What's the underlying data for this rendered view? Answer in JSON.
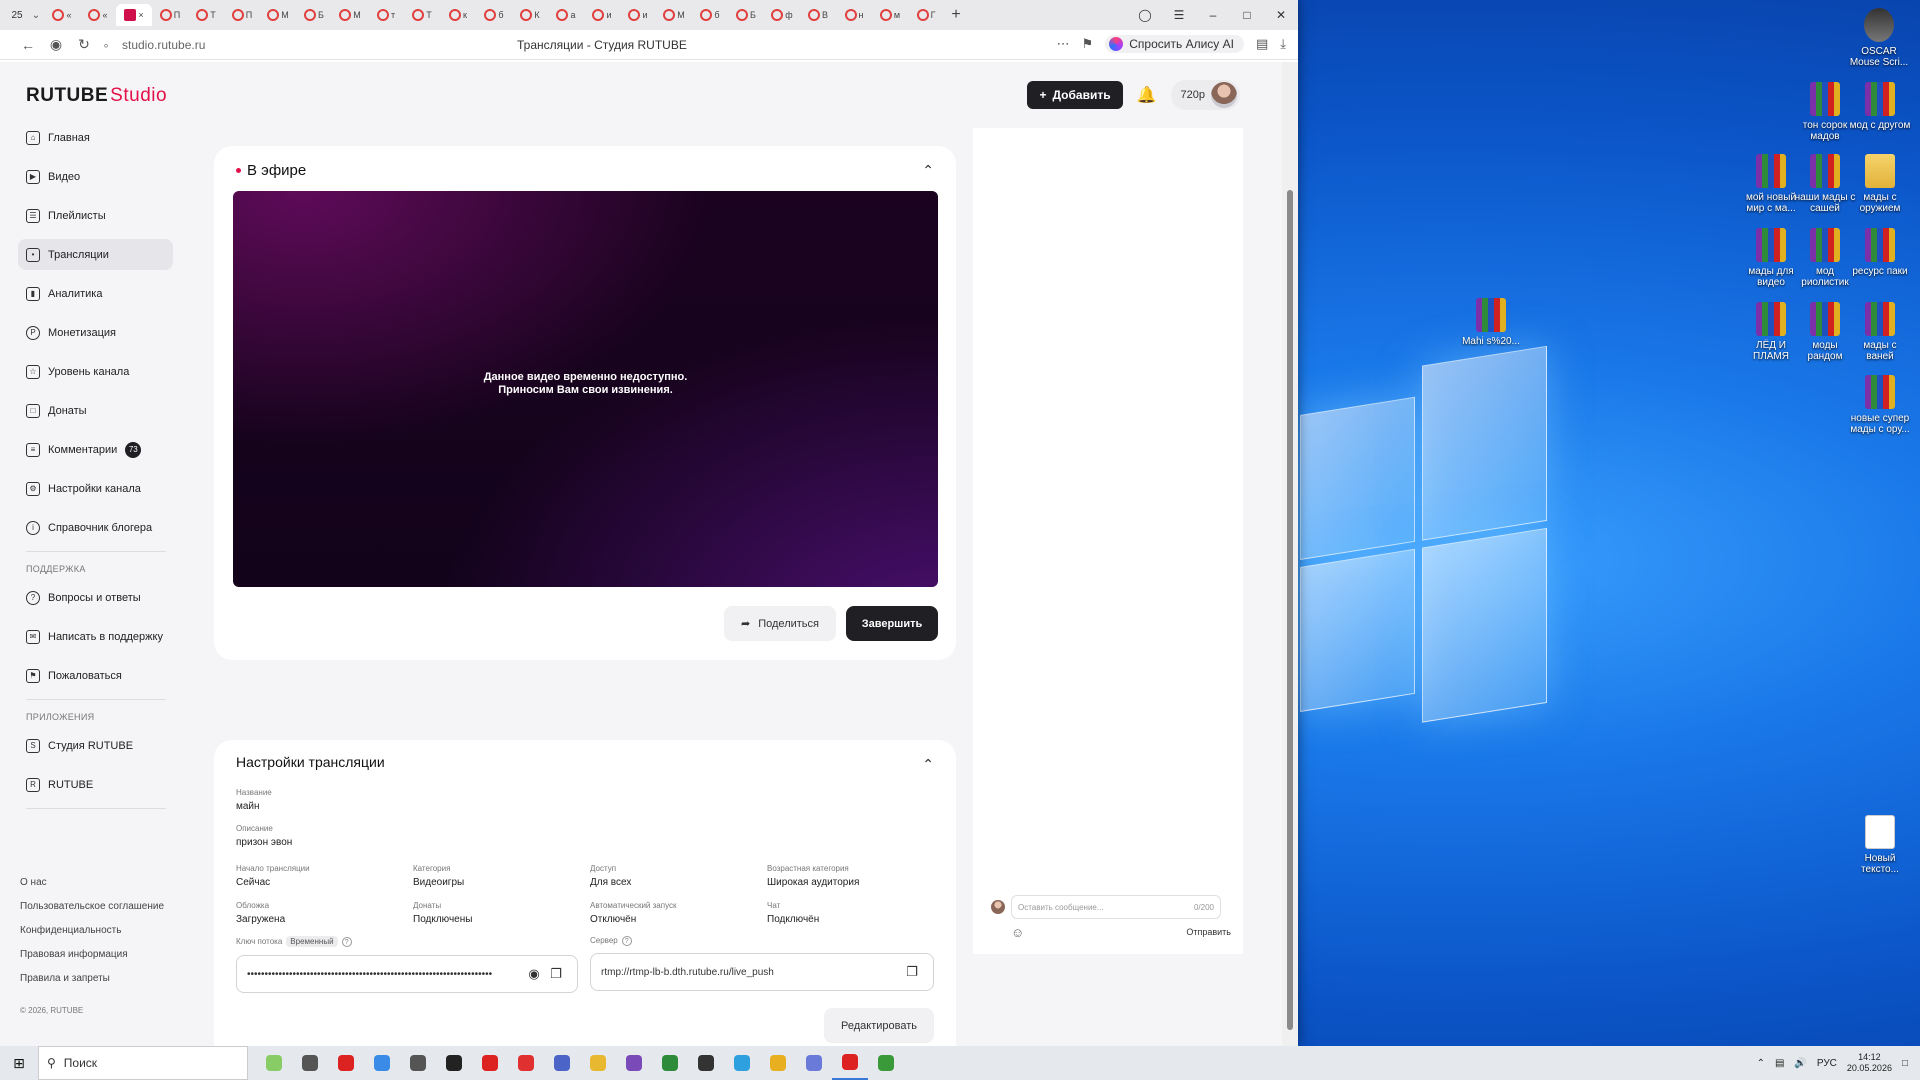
{
  "browser": {
    "tab_count": "25",
    "tabs": [
      {
        "label": "«"
      },
      {
        "label": "«"
      },
      {
        "label": "×",
        "active": true
      },
      {
        "label": "П"
      },
      {
        "label": "Т"
      },
      {
        "label": "П"
      },
      {
        "label": "М"
      },
      {
        "label": "Б"
      },
      {
        "label": "М"
      },
      {
        "label": "т"
      },
      {
        "label": "Т"
      },
      {
        "label": "к"
      },
      {
        "label": "б"
      },
      {
        "label": "К"
      },
      {
        "label": "а"
      },
      {
        "label": "и"
      },
      {
        "label": "и"
      },
      {
        "label": "М"
      },
      {
        "label": "б"
      },
      {
        "label": "Б"
      },
      {
        "label": "ф"
      },
      {
        "label": "В"
      },
      {
        "label": "н"
      },
      {
        "label": "м"
      },
      {
        "label": "Г"
      }
    ],
    "url": "studio.rutube.ru",
    "page_title": "Трансляции - Студия RUTUBE",
    "alice_label": "Спросить Алису AI"
  },
  "header": {
    "logo_main": "RUTUBE",
    "logo_sub": "Studio",
    "add_label": "Добавить",
    "quality": "720p"
  },
  "sidebar": {
    "items": [
      {
        "label": "Главная",
        "icon": "home-icon"
      },
      {
        "label": "Видео",
        "icon": "video-icon"
      },
      {
        "label": "Плейлисты",
        "icon": "playlist-icon"
      },
      {
        "label": "Трансляции",
        "icon": "broadcast-icon",
        "active": true
      },
      {
        "label": "Аналитика",
        "icon": "analytics-icon"
      },
      {
        "label": "Монетизация",
        "icon": "monetization-icon"
      },
      {
        "label": "Уровень канала",
        "icon": "star-icon"
      },
      {
        "label": "Донаты",
        "icon": "donate-icon"
      },
      {
        "label": "Комментарии",
        "icon": "comment-icon",
        "badge": "73"
      },
      {
        "label": "Настройки канала",
        "icon": "gear-icon"
      },
      {
        "label": "Справочник блогера",
        "icon": "info-icon"
      }
    ],
    "support_title": "ПОДДЕРЖКА",
    "support_items": [
      {
        "label": "Вопросы и ответы",
        "icon": "question-icon"
      },
      {
        "label": "Написать в поддержку",
        "icon": "mail-icon"
      },
      {
        "label": "Пожаловаться",
        "icon": "flag-icon"
      }
    ],
    "apps_title": "ПРИЛОЖЕНИЯ",
    "apps_items": [
      {
        "label": "Студия RUTUBE",
        "icon": "studio-app-icon"
      },
      {
        "label": "RUTUBE",
        "icon": "rutube-app-icon"
      }
    ],
    "footer_links": [
      "О нас",
      "Пользовательское соглашение",
      "Конфиденциальность",
      "Правовая информация",
      "Правила и запреты"
    ],
    "copyright": "© 2026, RUTUBE"
  },
  "live": {
    "title": "В эфире",
    "player_msg_line1": "Данное видео временно недоступно.",
    "player_msg_line2": "Приносим Вам свои извинения.",
    "share_label": "Поделиться",
    "finish_label": "Завершить"
  },
  "settings": {
    "title": "Настройки трансляции",
    "name_label": "Название",
    "name_value": "майн",
    "desc_label": "Описание",
    "desc_value": "призон эвон",
    "grid": [
      {
        "label": "Начало трансляции",
        "value": "Сейчас"
      },
      {
        "label": "Категория",
        "value": "Видеоигры"
      },
      {
        "label": "Доступ",
        "value": "Для всех"
      },
      {
        "label": "Возрастная категория",
        "value": "Широкая аудитория"
      },
      {
        "label": "Обложка",
        "value": "Загружена"
      },
      {
        "label": "Донаты",
        "value": "Подключены"
      },
      {
        "label": "Автоматический запуск",
        "value": "Отключён"
      },
      {
        "label": "Чат",
        "value": "Подключён"
      }
    ],
    "key_label": "Ключ потока",
    "key_badge": "Временный",
    "key_value": "••••••••••••••••••••••••••••••••••••••••••••••••••••••••••••••••••••••",
    "server_label": "Сервер",
    "server_value": "rtmp://rtmp-lb-b.dth.rutube.ru/live_push",
    "edit_label": "Редактировать"
  },
  "chat": {
    "placeholder": "Оставить сообщение...",
    "counter": "0/200",
    "send_label": "Отправить"
  },
  "desktop": {
    "icons": [
      {
        "label": "OSCAR Mouse Scri...",
        "type": "app"
      },
      {
        "label": "тон сорок мадов",
        "type": "rar"
      },
      {
        "label": "мод с другом",
        "type": "rar"
      },
      {
        "label": "мой новый мир с ма...",
        "type": "rar"
      },
      {
        "label": "наши мады с сашей",
        "type": "rar"
      },
      {
        "label": "мады с оружием",
        "type": "folder"
      },
      {
        "label": "мады для видео",
        "type": "rar"
      },
      {
        "label": "мод риолистик",
        "type": "rar"
      },
      {
        "label": "ресурс паки",
        "type": "rar"
      },
      {
        "label": "Mahi s%20...",
        "type": "rar"
      },
      {
        "label": "ЛЁД И ПЛАМЯ",
        "type": "rar"
      },
      {
        "label": "моды рандом",
        "type": "rar"
      },
      {
        "label": "мады с ваней",
        "type": "rar"
      },
      {
        "label": "новые супер мады с ору...",
        "type": "rar"
      },
      {
        "label": "Новый тексто...",
        "type": "txt"
      }
    ]
  },
  "taskbar": {
    "search_placeholder": "Поиск",
    "lang": "РУС",
    "time": "14:12",
    "date": "20.05.2026"
  }
}
